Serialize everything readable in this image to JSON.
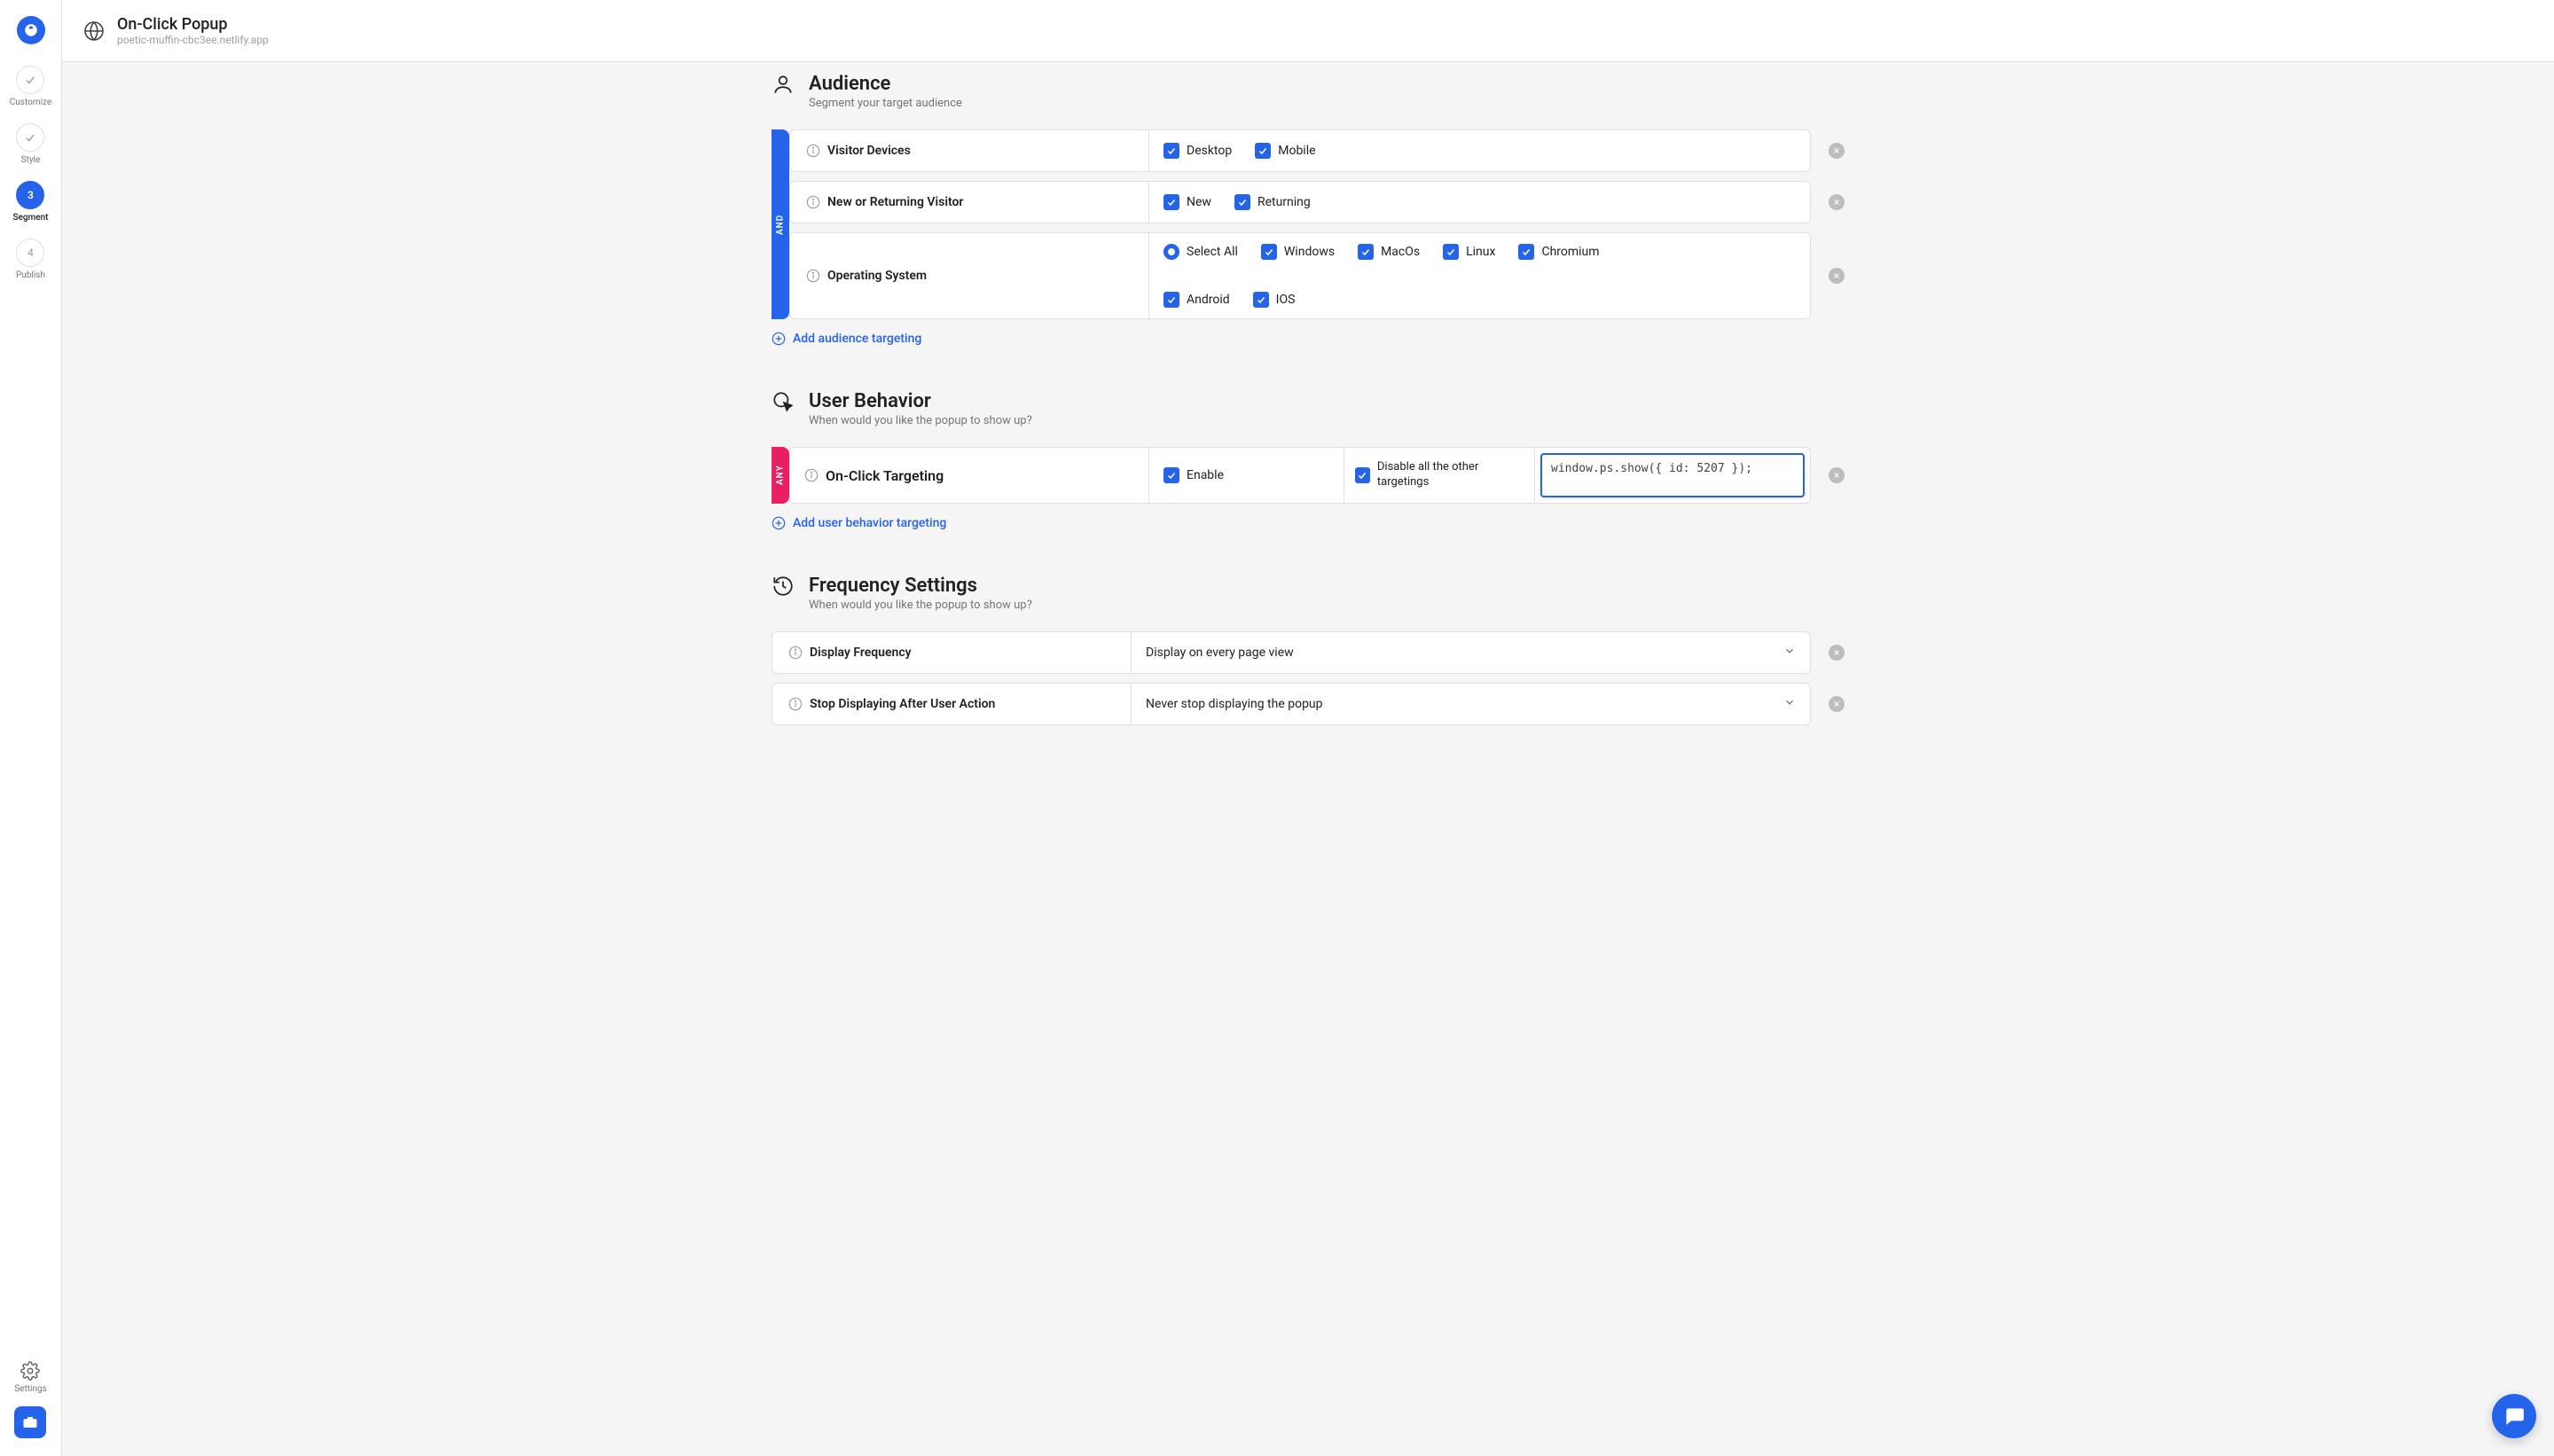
{
  "header": {
    "title": "On-Click Popup",
    "subtitle": "poetic-muffin-cbc3ee.netlify.app"
  },
  "rail": {
    "steps": [
      {
        "label": "Customize",
        "state": "done"
      },
      {
        "label": "Style",
        "state": "done"
      },
      {
        "label": "Segment",
        "state": "active",
        "num": "3"
      },
      {
        "label": "Publish",
        "state": "todo",
        "num": "4"
      }
    ],
    "settings_label": "Settings"
  },
  "audience": {
    "title": "Audience",
    "subtitle": "Segment your target audience",
    "operator": "AND",
    "rules": [
      {
        "label": "Visitor Devices",
        "options": [
          {
            "text": "Desktop",
            "checked": true
          },
          {
            "text": "Mobile",
            "checked": true
          }
        ]
      },
      {
        "label": "New or Returning Visitor",
        "options": [
          {
            "text": "New",
            "checked": true
          },
          {
            "text": "Returning",
            "checked": true
          }
        ]
      },
      {
        "label": "Operating System",
        "row1": [
          {
            "text": "Select All",
            "type": "radio"
          },
          {
            "text": "Windows",
            "checked": true
          },
          {
            "text": "MacOs",
            "checked": true
          },
          {
            "text": "Linux",
            "checked": true
          },
          {
            "text": "Chromium",
            "checked": true
          }
        ],
        "row2": [
          {
            "text": "Android",
            "checked": true
          },
          {
            "text": "IOS",
            "checked": true
          }
        ]
      }
    ],
    "add_label": "Add audience targeting"
  },
  "behavior": {
    "title": "User Behavior",
    "subtitle": "When would you like the popup to show up?",
    "operator": "ANY",
    "rule": {
      "label": "On-Click Targeting",
      "enable_label": "Enable",
      "disable_label": "Disable all the other targetings",
      "code": "window.ps.show({ id: 5207 });"
    },
    "add_label": "Add user behavior targeting"
  },
  "frequency": {
    "title": "Frequency Settings",
    "subtitle": "When would you like the popup to show up?",
    "rows": [
      {
        "label": "Display Frequency",
        "value": "Display on every page view"
      },
      {
        "label": "Stop Displaying After User Action",
        "value": "Never stop displaying the popup"
      }
    ]
  }
}
